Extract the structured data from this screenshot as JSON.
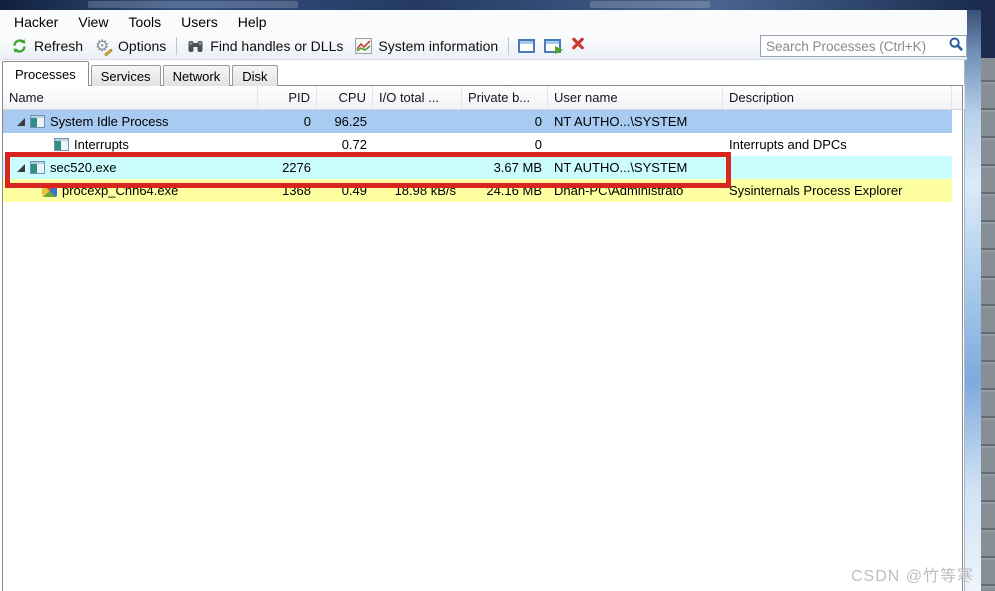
{
  "menu": {
    "items": [
      "Hacker",
      "View",
      "Tools",
      "Users",
      "Help"
    ]
  },
  "toolbar": {
    "buttons": [
      {
        "label": "Refresh",
        "icon": "refresh-icon"
      },
      {
        "label": "Options",
        "icon": "gear-icon"
      },
      {
        "label": "Find handles or DLLs",
        "icon": "binoculars-icon"
      },
      {
        "label": "System information",
        "icon": "system-chart-icon"
      }
    ],
    "icon_buttons": [
      "new-window-icon",
      "window-arrow-icon",
      "kill-x-icon"
    ],
    "search_placeholder": "Search Processes (Ctrl+K)"
  },
  "tabs": [
    {
      "label": "Processes",
      "active": true
    },
    {
      "label": "Services",
      "active": false
    },
    {
      "label": "Network",
      "active": false
    },
    {
      "label": "Disk",
      "active": false
    }
  ],
  "table": {
    "columns": [
      {
        "key": "name",
        "label": "Name",
        "align": "left"
      },
      {
        "key": "pid",
        "label": "PID",
        "align": "right"
      },
      {
        "key": "cpu",
        "label": "CPU",
        "align": "right"
      },
      {
        "key": "io",
        "label": "I/O total ...",
        "align": "left"
      },
      {
        "key": "private",
        "label": "Private b...",
        "align": "left"
      },
      {
        "key": "user",
        "label": "User name",
        "align": "left"
      },
      {
        "key": "description",
        "label": "Description",
        "align": "left"
      }
    ],
    "rows": [
      {
        "name": "System Idle Process",
        "pid": "0",
        "cpu": "96.25",
        "io": "",
        "private": "0",
        "user": "NT AUTHO...\\SYSTEM",
        "description": "",
        "indent": 0,
        "expander": true,
        "highlight": "selected",
        "icon": "default-app-icon"
      },
      {
        "name": "Interrupts",
        "pid": "",
        "cpu": "0.72",
        "io": "",
        "private": "0",
        "user": "",
        "description": "Interrupts and DPCs",
        "indent": 1,
        "expander": false,
        "highlight": "none",
        "icon": "default-app-icon"
      },
      {
        "name": "sec520.exe",
        "pid": "2276",
        "cpu": "",
        "io": "",
        "private": "3.67 MB",
        "user": "NT AUTHO...\\SYSTEM",
        "description": "",
        "indent": 0,
        "expander": true,
        "highlight": "new",
        "icon": "default-app-icon"
      },
      {
        "name": "procexp_Chn64.exe",
        "pid": "1368",
        "cpu": "0.49",
        "io": "18.98 kB/s",
        "private": "24.16 MB",
        "user": "Dhan-PC\\Administrato",
        "description": "Sysinternals Process Explorer",
        "indent": 0.5,
        "expander": false,
        "highlight": "packed",
        "icon": "procexp-icon"
      }
    ]
  },
  "colors": {
    "selected_row": "#a8cbf1",
    "new_object_row": "#ccfdfe",
    "packed_row": "#feffa0",
    "annotation_red": "#da241f"
  },
  "watermark": "CSDN @竹等寒"
}
